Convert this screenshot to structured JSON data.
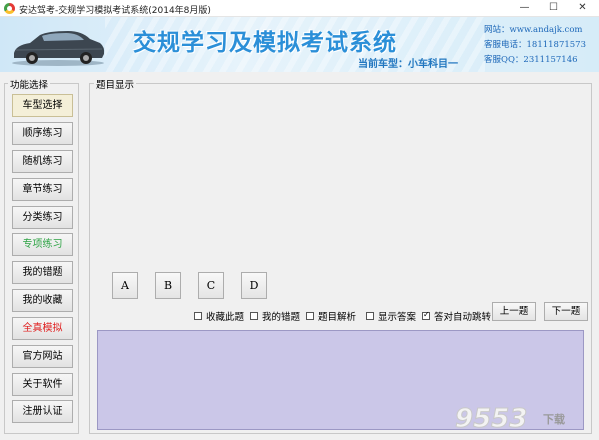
{
  "window": {
    "title": "安达驾考-交规学习模拟考试系统(2014年8月版)",
    "minimize_glyph": "—",
    "maximize_glyph": "☐",
    "close_glyph": "✕"
  },
  "banner": {
    "title": "交规学习及模拟考试系统",
    "current_car": "当前车型：小车科目一",
    "website": "网站：www.andajk.com",
    "phone": "客服电话：18111871573",
    "qq": "客服QQ：2311157146",
    "car_image": "car-icon"
  },
  "left_panel": {
    "legend": "功能选择",
    "buttons": [
      "车型选择",
      "顺序练习",
      "随机练习",
      "章节练习",
      "分类练习",
      "专项练习",
      "我的错题",
      "我的收藏",
      "全真模拟",
      "官方网站",
      "关于软件",
      "注册认证"
    ]
  },
  "main_panel": {
    "legend": "题目显示",
    "answer_buttons": [
      "A",
      "B",
      "C",
      "D"
    ],
    "options": [
      {
        "label": "收藏此题",
        "checked": false
      },
      {
        "label": "我的错题",
        "checked": false
      },
      {
        "label": "题目解析",
        "checked": false
      },
      {
        "label": "显示答案",
        "checked": false
      },
      {
        "label": "答对自动跳转",
        "checked": true
      }
    ],
    "prev_label": "上一题",
    "next_label": "下一题"
  },
  "watermark": {
    "text": "9553",
    "sub": "下载"
  },
  "colors": {
    "banner_title": "#2b8fd8",
    "answer_area": "#cbc7e8",
    "green_button": "#2da344",
    "red_button": "#e02020"
  }
}
